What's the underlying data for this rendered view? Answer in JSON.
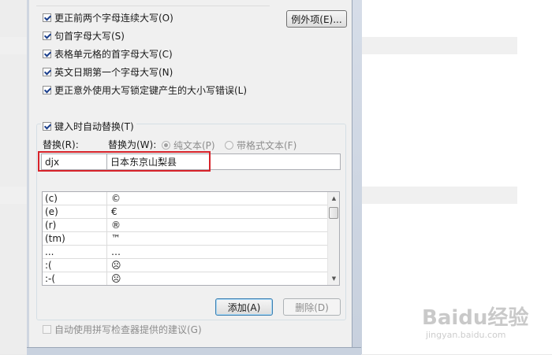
{
  "options": [
    {
      "label": "更正前两个字母连续大写(O)",
      "checked": true
    },
    {
      "label": "句首字母大写(S)",
      "checked": true
    },
    {
      "label": "表格单元格的首字母大写(C)",
      "checked": true
    },
    {
      "label": "英文日期第一个字母大写(N)",
      "checked": true
    },
    {
      "label": "更正意外使用大写锁定键产生的大小写错误(L)",
      "checked": true
    }
  ],
  "exceptions_button": "例外项(E)...",
  "autoreplace": {
    "group_label": "键入时自动替换(T)",
    "checked": true,
    "replace_label": "替换(R):",
    "with_label": "替换为(W):",
    "plain_text": "纯文本(P)",
    "formatted_text": "带格式文本(F)",
    "replace_value": "djx",
    "with_value": "日本东京山梨县"
  },
  "entries": [
    {
      "key": "(c)",
      "value": "©"
    },
    {
      "key": "(e)",
      "value": "€"
    },
    {
      "key": "(r)",
      "value": "®"
    },
    {
      "key": "(tm)",
      "value": "™"
    },
    {
      "key": "...",
      "value": "…"
    },
    {
      "key": ":(",
      "value": "☹"
    },
    {
      "key": ":-(",
      "value": "☹"
    }
  ],
  "buttons": {
    "add": "添加(A)",
    "delete": "删除(D)"
  },
  "spellcheck_label": "自动使用拼写检查器提供的建议(G)",
  "watermark": {
    "logo": "Baidu经验",
    "url": "jingyan.baidu.com"
  },
  "colors": {
    "highlight": "#d8232a",
    "accent": "#3c7fb1"
  }
}
